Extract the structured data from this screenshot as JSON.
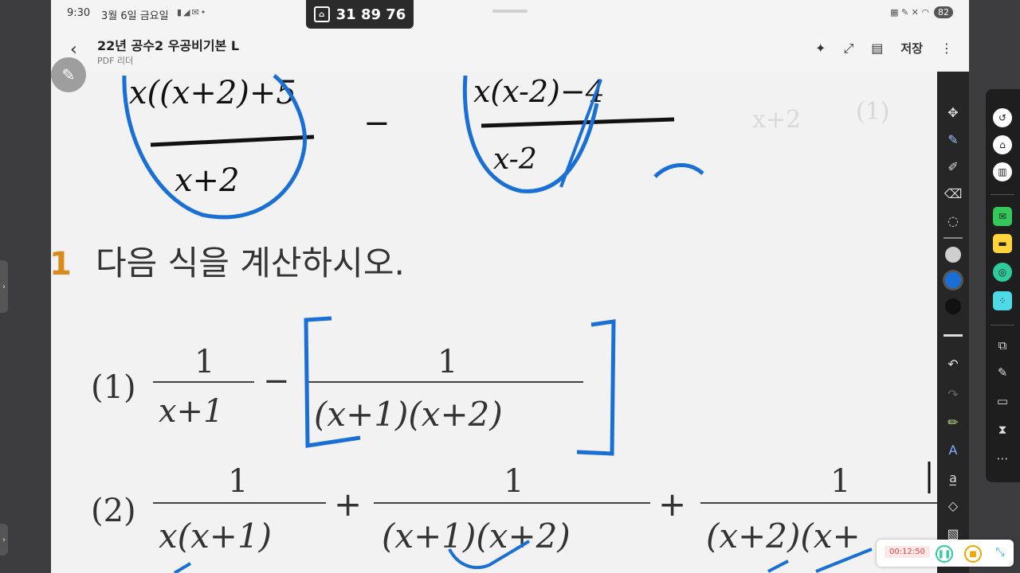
{
  "status": {
    "time": "9:30",
    "date": "3월 6일 금요일",
    "left_icons": "▮◢✉•",
    "right_icons": "▦ ✎ ✕ ◠",
    "battery": "82"
  },
  "pill": {
    "code": "31 89 76",
    "icon": "clipboard-icon"
  },
  "appbar": {
    "title": "22년 공수2 우공비기본 L",
    "subtitle": "PDF 리더",
    "save_label": "저장"
  },
  "document": {
    "prompt_number": "1",
    "prompt": "다음 식을 계산하시오.",
    "problems": [
      {
        "label": "(1)",
        "fractions": [
          {
            "num": "1",
            "den": "x+1"
          },
          {
            "op": "−"
          },
          {
            "num": "1",
            "den": "(x+1)(x+2)"
          }
        ]
      },
      {
        "label": "(2)",
        "fractions": [
          {
            "num": "1",
            "den": "x(x+1)"
          },
          {
            "op": "+"
          },
          {
            "num": "1",
            "den": "(x+1)(x+2)"
          },
          {
            "op": "+"
          },
          {
            "num": "1",
            "den": "(x+2)(x+"
          }
        ]
      }
    ],
    "handwriting_top_left_num": "x((x+2)+5",
    "handwriting_top_left_den": "x+2",
    "handwriting_top_right_num": "x(x-2)−4",
    "handwriting_top_right_den": "x-2",
    "handwriting_minus": "−"
  },
  "recorder": {
    "elapsed": "00:12:50"
  },
  "colors": {
    "ink_blue": "#1a6fd6",
    "toolbar_bg": "#262626",
    "page_bg": "#f2f2f2"
  }
}
